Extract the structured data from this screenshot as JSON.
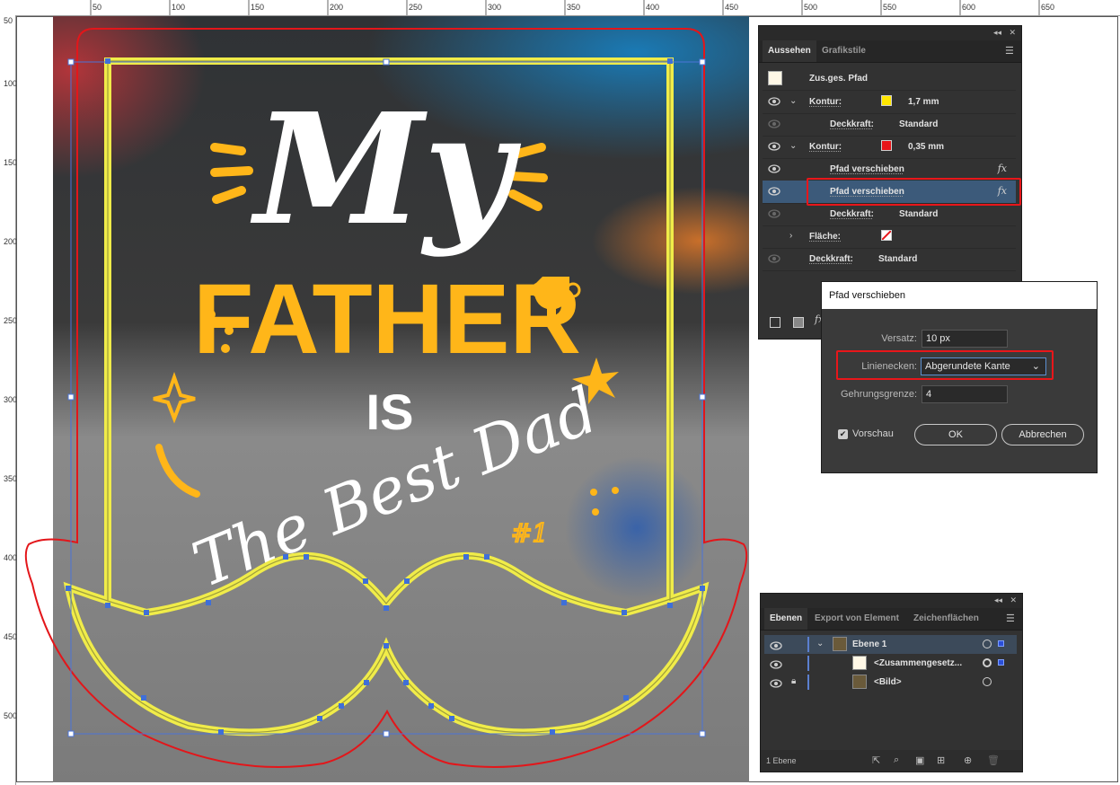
{
  "ruler": {
    "top_ticks": [
      "50",
      "100",
      "150",
      "200",
      "250",
      "300",
      "350",
      "400",
      "450",
      "500",
      "550",
      "600",
      "650"
    ],
    "left_ticks": [
      "50",
      "100",
      "150",
      "200",
      "250",
      "300",
      "350",
      "400",
      "450",
      "500"
    ]
  },
  "artwork": {
    "line1": "My",
    "line2": "FATHER",
    "line3": "IS",
    "line4": "The Best Dad",
    "badge": "#1",
    "colors": {
      "yellow_text": "#ffb619",
      "white_text": "#ffffff",
      "path_yellow": "#f0ec49",
      "path_red": "#e3161a",
      "anchor_blue": "#3f6fd8"
    }
  },
  "appearance_panel": {
    "tabs": [
      "Aussehen",
      "Grafikstile"
    ],
    "active_tab": "Aussehen",
    "object_label": "Zus.ges. Pfad",
    "rows": [
      {
        "label": "Kontur:",
        "swatch": "#ffe600",
        "value": "1,7 mm"
      },
      {
        "label": "Deckkraft:",
        "value": "Standard"
      },
      {
        "label": "Kontur:",
        "swatch": "#e8161a",
        "value": "0,35 mm"
      },
      {
        "label": "Pfad verschieben",
        "fx": "fx"
      },
      {
        "label": "Pfad verschieben",
        "fx": "fx"
      },
      {
        "label": "Deckkraft:",
        "value": "Standard"
      },
      {
        "label": "Fläche:",
        "swatch": "none"
      },
      {
        "label": "Deckkraft:",
        "value": "Standard"
      }
    ],
    "footer_fx": "fx"
  },
  "dialog": {
    "title": "Pfad verschieben",
    "offset_label": "Versatz:",
    "offset_value": "10 px",
    "joins_label": "Linienecken:",
    "joins_value": "Abgerundete Kante",
    "miter_label": "Gehrungsgrenze:",
    "miter_value": "4",
    "preview_label": "Vorschau",
    "preview_checked": true,
    "ok": "OK",
    "cancel": "Abbrechen"
  },
  "layers_panel": {
    "tabs": [
      "Ebenen",
      "Export von Element",
      "Zeichenflächen"
    ],
    "active_tab": "Ebenen",
    "rows": [
      {
        "name": "Ebene 1"
      },
      {
        "name": "<Zusammengesetz..."
      },
      {
        "name": "<Bild>"
      }
    ],
    "footer_count": "1 Ebene"
  }
}
